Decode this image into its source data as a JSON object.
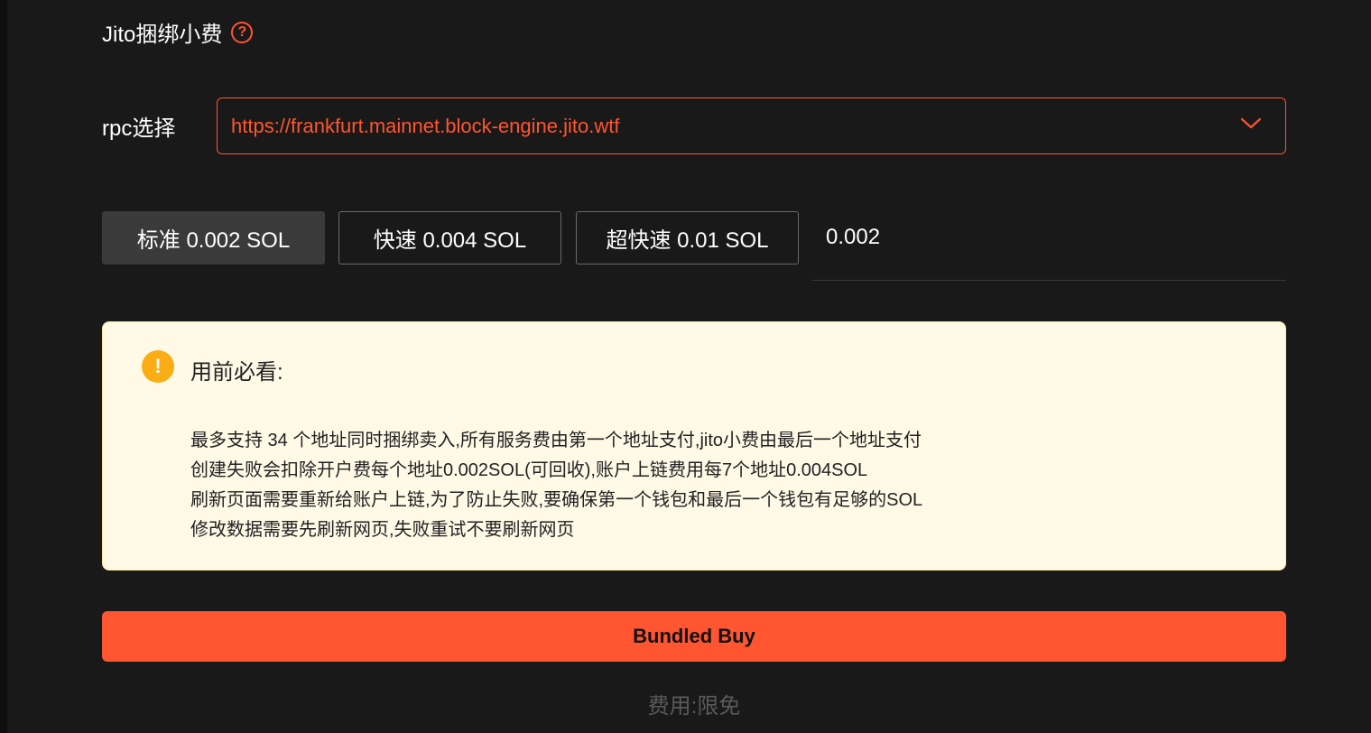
{
  "section": {
    "title": "Jito捆绑小费",
    "help_icon": "question-circle-icon"
  },
  "rpc": {
    "label": "rpc选择",
    "selected": "https://frankfurt.mainnet.block-engine.jito.wtf",
    "icon": "chevron-down-icon"
  },
  "fee_options": [
    {
      "label": "标准 0.002 SOL",
      "active": true
    },
    {
      "label": "快速 0.004 SOL",
      "active": false
    },
    {
      "label": "超快速 0.01 SOL",
      "active": false
    }
  ],
  "custom_fee": {
    "value": "0.002"
  },
  "notice": {
    "icon": "exclamation-circle-icon",
    "title": "用前必看:",
    "lines": [
      "最多支持 34 个地址同时捆绑卖入,所有服务费由第一个地址支付,jito小费由最后一个地址支付",
      "创建失败会扣除开户费每个地址0.002SOL(可回收),账户上链费用每7个地址0.004SOL",
      "刷新页面需要重新给账户上链,为了防止失败,要确保第一个钱包和最后一个钱包有足够的SOL",
      "修改数据需要先刷新网页,失败重试不要刷新网页"
    ]
  },
  "action": {
    "buy_label": "Bundled Buy"
  },
  "footer": {
    "fee_note": "费用:限免"
  },
  "colors": {
    "accent": "#ff5530",
    "warning": "#faad14",
    "notice_bg": "#fff9e6",
    "background": "#191919"
  }
}
